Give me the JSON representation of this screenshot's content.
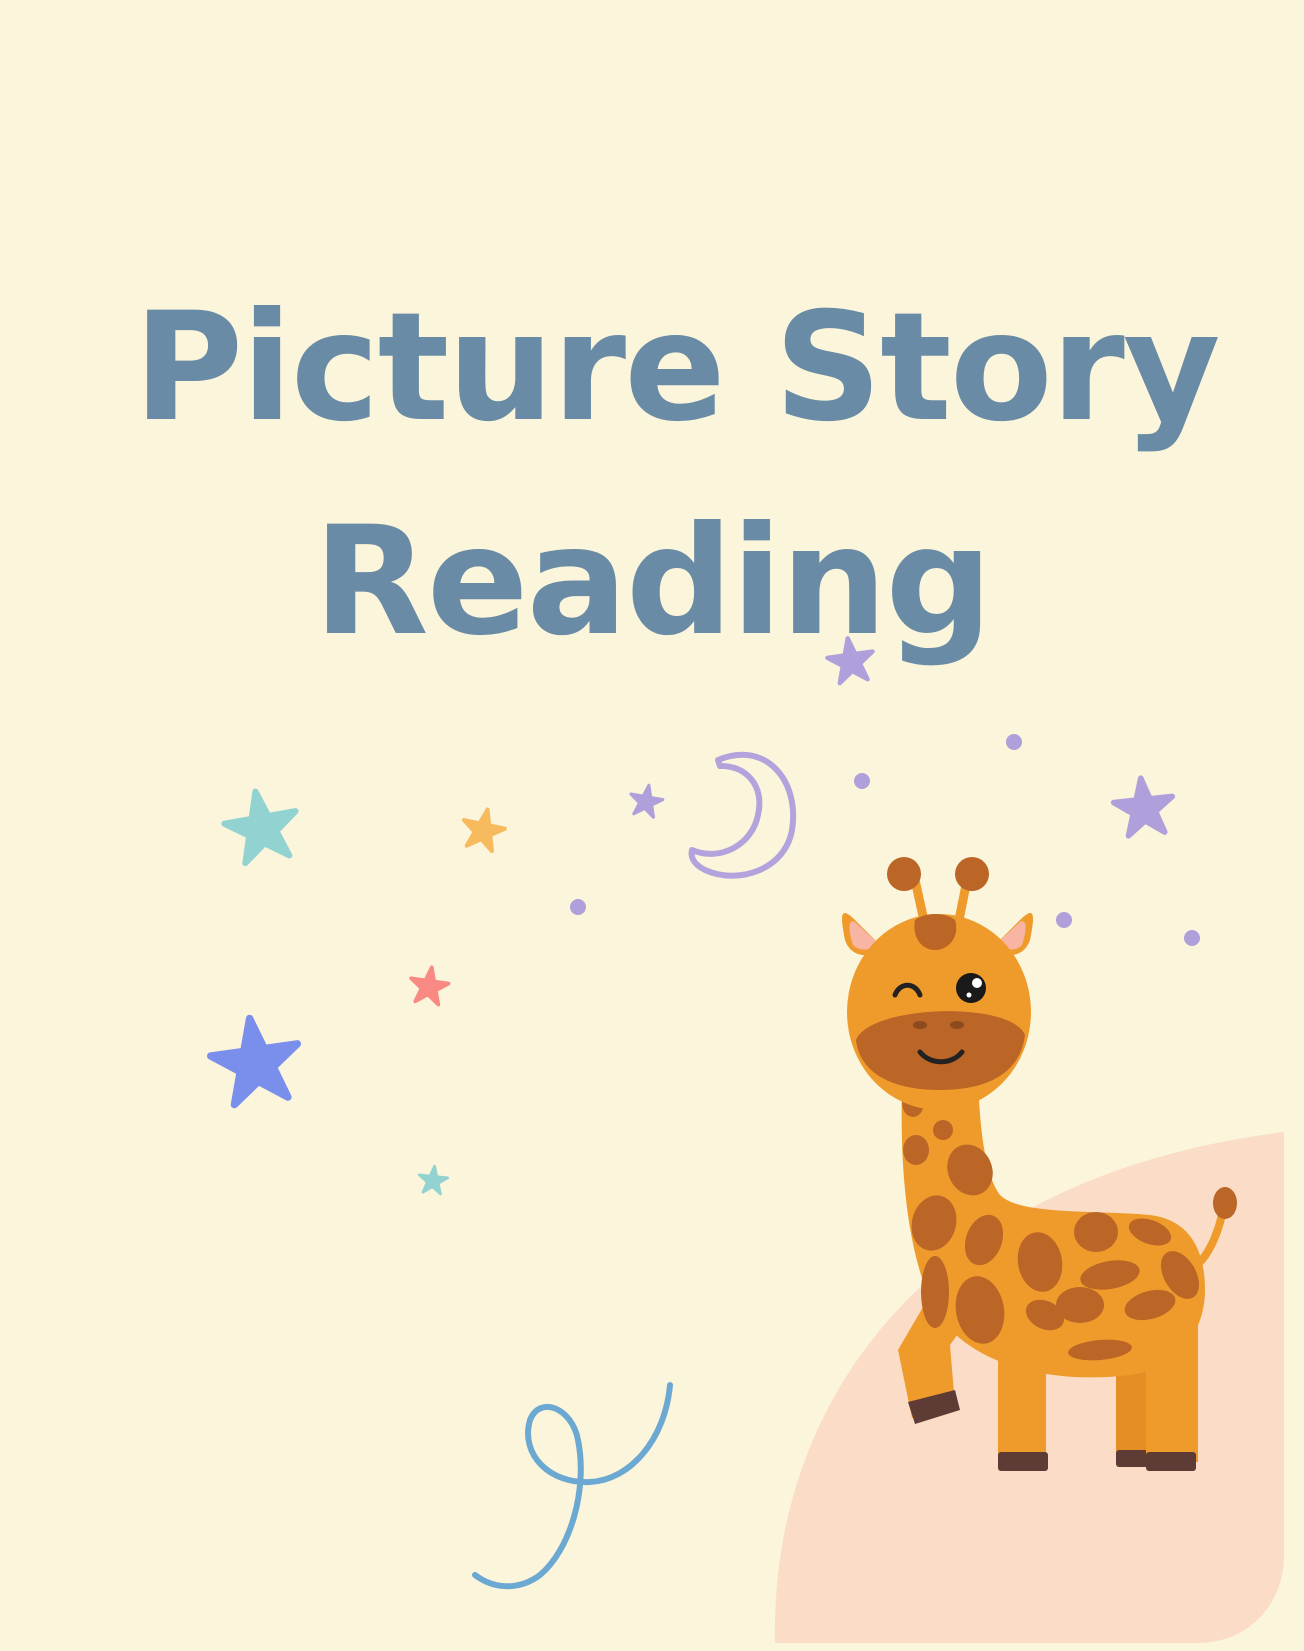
{
  "title": {
    "line1": "Picture Story",
    "line2": "Reading"
  },
  "colors": {
    "background": "#FBF5DB",
    "title": "#698BA5",
    "corner_blob": "#FBDCC7",
    "giraffe_body": "#EF9B2C",
    "giraffe_spots": "#BB6526",
    "giraffe_hooves": "#5F3B35",
    "giraffe_ear_inner": "#F9B5A4",
    "moon": "#B2A3DC",
    "squiggle": "#6CA9D2"
  },
  "decorations": [
    "teal-star-icon",
    "orange-star-icon",
    "purple-star-icon",
    "moon-icon",
    "pink-star-icon",
    "blue-star-icon",
    "squiggle-line",
    "giraffe-illustration"
  ]
}
